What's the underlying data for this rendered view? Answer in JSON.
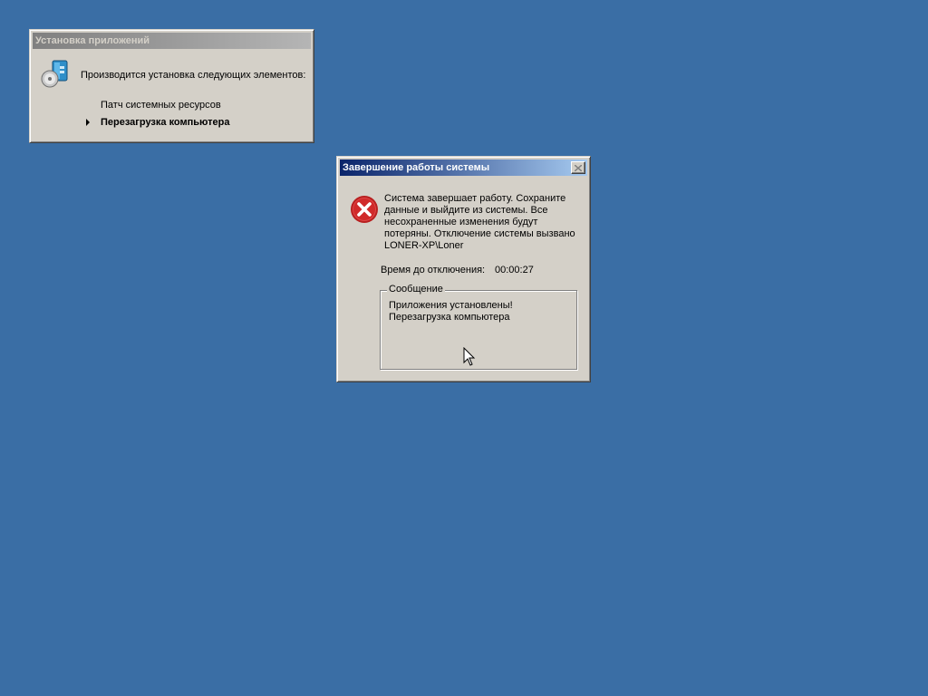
{
  "desktop": {
    "background_color": "#3a6ea5"
  },
  "installer_window": {
    "title": "Установка приложений",
    "icon": "install-package-icon",
    "heading": "Производится установка следующих элементов:",
    "items": [
      {
        "label": "Патч системных ресурсов",
        "current": false
      },
      {
        "label": "Перезагрузка компьютера",
        "current": true
      }
    ]
  },
  "shutdown_dialog": {
    "title": "Завершение работы системы",
    "icon": "error-icon",
    "message_lines": [
      "Система завершает работу.  Сохраните",
      "данные и выйдите из системы.  Все",
      "несохраненные изменения будут",
      "потеряны.  Отключение системы вызвано",
      "LONER-XP\\Loner"
    ],
    "timer_label": "Время до отключения:",
    "timer_value": "00:00:27",
    "message_group": {
      "legend": "Сообщение",
      "lines": [
        "Приложения установлены!",
        "Перезагрузка компьютера"
      ]
    }
  },
  "colors": {
    "active_title_start": "#0a246a",
    "active_title_end": "#a6caf0",
    "inactive_title_start": "#808080",
    "inactive_title_end": "#b5b5b5",
    "window_face": "#d4d0c8",
    "error_red": "#cc2a2a"
  }
}
